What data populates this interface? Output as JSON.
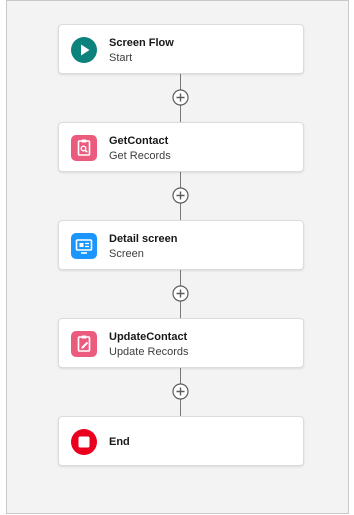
{
  "nodes": [
    {
      "title": "Screen Flow",
      "subtitle": "Start",
      "icon": "play-icon",
      "color": "#0b827c"
    },
    {
      "title": "GetContact",
      "subtitle": "Get Records",
      "icon": "record-lookup-icon",
      "color": "#ea5b7d"
    },
    {
      "title": "Detail screen",
      "subtitle": "Screen",
      "icon": "screen-icon",
      "color": "#1b96ff"
    },
    {
      "title": "UpdateContact",
      "subtitle": "Update Records",
      "icon": "record-update-icon",
      "color": "#ea5b7d"
    },
    {
      "title": "End",
      "subtitle": "",
      "icon": "stop-icon",
      "color": "#ea001e"
    }
  ],
  "connector": {
    "action": "add-element",
    "icon": "plus-circle-icon",
    "color": "#5c5c5c"
  }
}
